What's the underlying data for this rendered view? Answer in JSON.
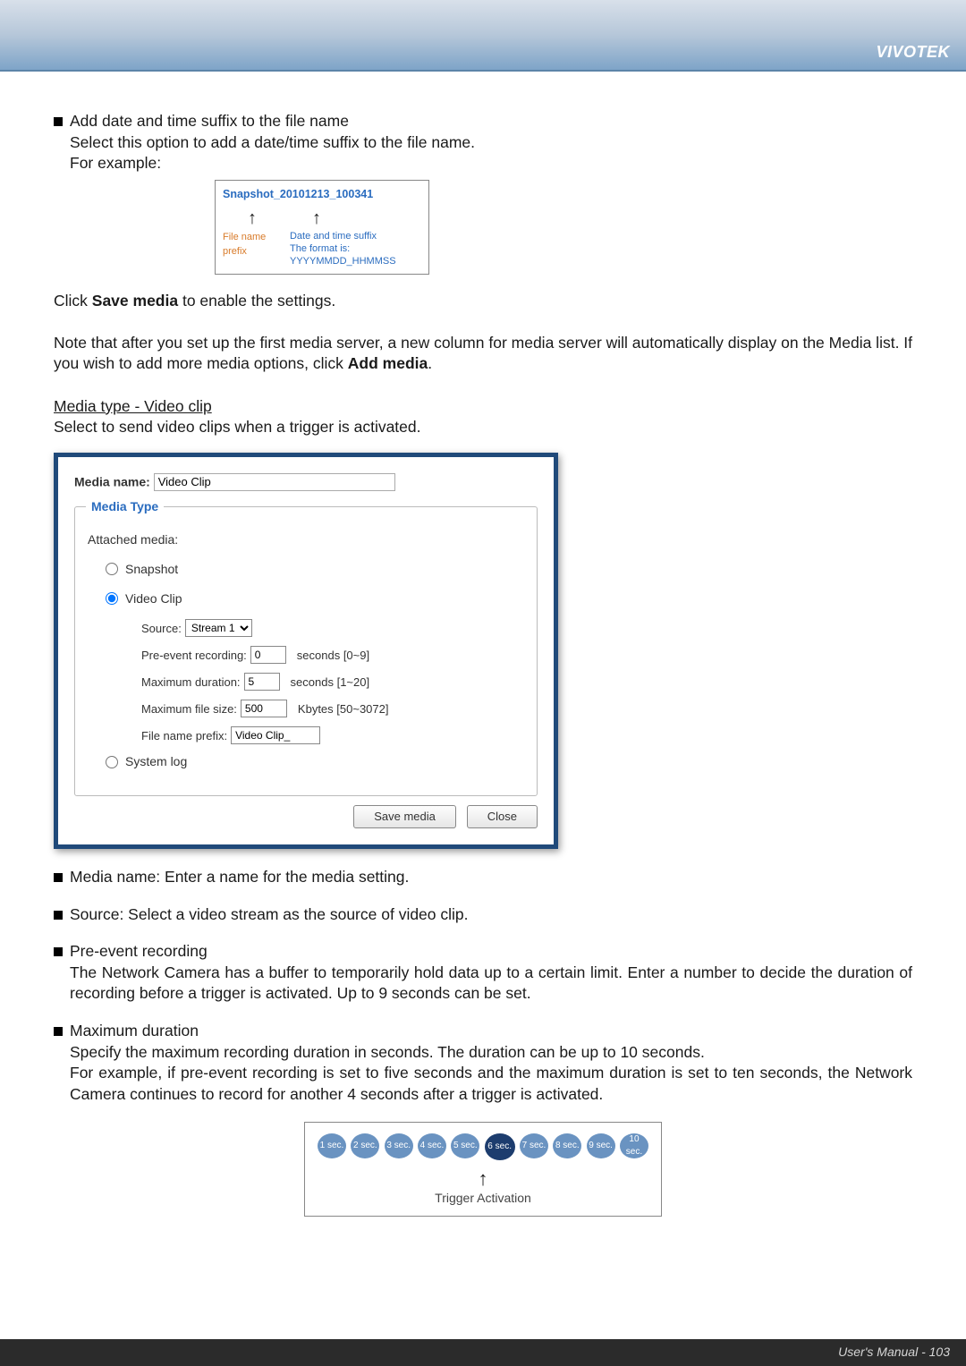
{
  "brand": "VIVOTEK",
  "p1": {
    "bullet": "Add date and time suffix to the file name",
    "line2": "Select this option to add a date/time suffix to the file name.",
    "line3": "For example:"
  },
  "snapshot": {
    "title": "Snapshot_20101213_100341",
    "arrow": "↑",
    "prefix_lbl": "File name prefix",
    "suffix_lbl": "Date and time suffix",
    "format_lbl": "The format is: YYYYMMDD_HHMMSS"
  },
  "click_save": {
    "pre": "Click ",
    "bold": "Save media",
    "post": " to enable the settings."
  },
  "note_media": {
    "line1": "Note that after you set up the first media server, a new column for media server will automatically display on the Media list.  If you wish to add more media options, click ",
    "bold": "Add media",
    "post": "."
  },
  "mtype_header": "Media type - Video clip",
  "mtype_desc": "Select to send video clips when a trigger is activated.",
  "panel": {
    "media_name_lbl": "Media name:",
    "media_name_val": "Video Clip",
    "legend": "Media Type",
    "attached": "Attached media:",
    "opt_snapshot": "Snapshot",
    "opt_videoclip": "Video Clip",
    "source_lbl": "Source:",
    "source_val": "Stream 1",
    "pre_lbl": "Pre-event recording:",
    "pre_val": "0",
    "pre_hint": "seconds [0~9]",
    "maxdur_lbl": "Maximum duration:",
    "maxdur_val": "5",
    "maxdur_hint": "seconds [1~20]",
    "maxsize_lbl": "Maximum file size:",
    "maxsize_val": "500",
    "maxsize_hint": "Kbytes [50~3072]",
    "prefix_lbl": "File name prefix:",
    "prefix_val": "Video Clip_",
    "opt_syslog": "System log",
    "btn_save": "Save media",
    "btn_close": "Close"
  },
  "bulletA": "Media name: Enter a name for the media setting.",
  "bulletB": "Source: Select a video stream as the source of video clip.",
  "bulletC_title": "Pre-event recording",
  "bulletC_body": "The Network Camera has a buffer to temporarily hold data up to a certain limit. Enter a number to decide the duration of recording before a trigger is activated. Up to 9 seconds can be set.",
  "bulletD_title": "Maximum duration",
  "bulletD_l1": "Specify the maximum recording duration in seconds. The duration can be up to 10 seconds.",
  "bulletD_l2": "For example, if pre-event recording is set to five seconds and the maximum duration is set to ten seconds, the Network Camera continues to record for another 4 seconds after a trigger is activated.",
  "timeline": {
    "dots": [
      "1 sec.",
      "2 sec.",
      "3 sec.",
      "4 sec.",
      "5 sec.",
      "6 sec.",
      "7 sec.",
      "8 sec.",
      "9 sec.",
      "10 sec."
    ],
    "active_index": 5,
    "arrow": "↑",
    "label": "Trigger Activation"
  },
  "footer": {
    "manual": "User's Manual - ",
    "page": "103"
  }
}
